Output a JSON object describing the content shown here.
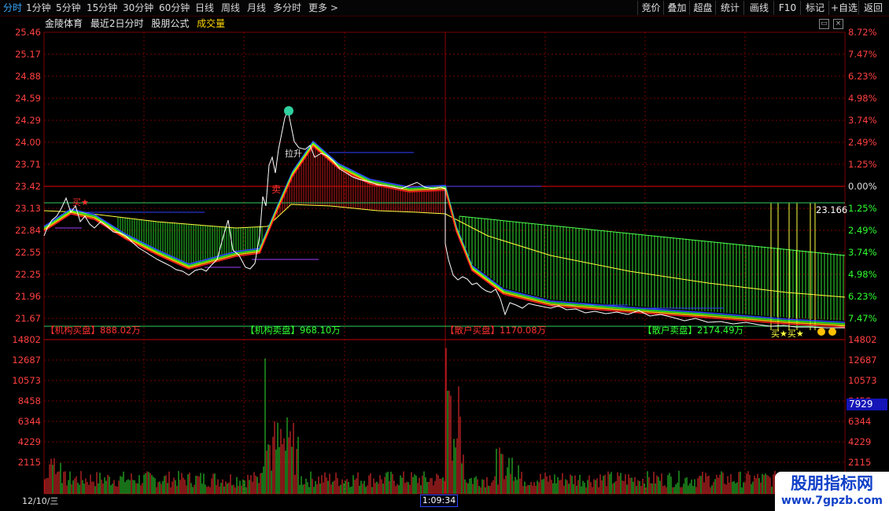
{
  "toolbar": {
    "tabs": [
      "分时",
      "1分钟",
      "5分钟",
      "15分钟",
      "30分钟",
      "60分钟",
      "日线",
      "周线",
      "月线",
      "多分时",
      "更多 >"
    ],
    "active_tab": "分时",
    "right_buttons": [
      "竞价",
      "叠加",
      "超盘",
      "统计",
      "画线",
      "F10",
      "标记",
      "+自选",
      "返回"
    ]
  },
  "info_line": {
    "stock_name": "金陵体育",
    "period": "最近2日分时",
    "formula": "股朋公式",
    "indicator": "成交量"
  },
  "price_axis_left": [
    "25.46",
    "25.17",
    "24.88",
    "24.59",
    "24.29",
    "24.00",
    "23.71",
    "23.42",
    "23.13",
    "22.84",
    "22.55",
    "22.25",
    "21.96",
    "21.67"
  ],
  "pct_axis_right": [
    "8.72%",
    "7.47%",
    "6.23%",
    "4.98%",
    "3.74%",
    "2.49%",
    "1.25%",
    "0.00%",
    "1.25%",
    "2.49%",
    "3.74%",
    "4.98%",
    "6.23%",
    "7.47%"
  ],
  "volume_axis": [
    "14802",
    "12687",
    "10573",
    "8458",
    "6344",
    "4229",
    "2115"
  ],
  "volume_current": "7929",
  "level_label": "23.166",
  "annotations": {
    "buy": "买",
    "sell": "卖",
    "pull": "拉升",
    "flags_bottom": "买★买★"
  },
  "flow_labels": [
    {
      "text": "【机构买盘】888.02万",
      "color": "#ff3030"
    },
    {
      "text": "【机构卖盘】968.10万",
      "color": "#30ff30"
    },
    {
      "text": "【散户买盘】1170.08万",
      "color": "#ff3030"
    },
    {
      "text": "【散户卖盘】2174.49万",
      "color": "#30ff30"
    }
  ],
  "date_label": "12/10/三",
  "time_cursor": "1:09:34",
  "watermark": {
    "line1": "股朋指标网",
    "line2": "www.7gpzb.com"
  },
  "colors": {
    "up": "#ff3030",
    "down": "#30ff30",
    "grid": "#7a0000",
    "price_line": "#ffffff",
    "avg_line": "#ffff40",
    "axis_text_red": "#ff4040"
  }
}
